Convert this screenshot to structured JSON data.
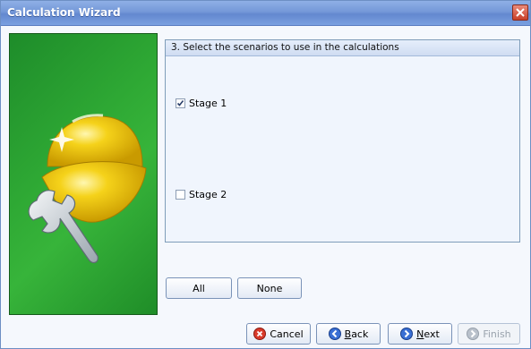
{
  "window": {
    "title": "Calculation Wizard"
  },
  "panel": {
    "header": "3. Select the scenarios to use in the calculations",
    "items": [
      {
        "label": "Stage 1",
        "checked": true
      },
      {
        "label": "Stage 2",
        "checked": false
      }
    ]
  },
  "selection_buttons": {
    "all": "All",
    "none": "None"
  },
  "footer": {
    "cancel": "Cancel",
    "back_first": "B",
    "back_rest": "ack",
    "next_first": "N",
    "next_rest": "ext",
    "finish": "Finish"
  },
  "icons": {
    "close": "close-icon",
    "banner": "hard-hat-wrench-icon",
    "cancel": "red-x-icon",
    "back": "blue-left-arrow-icon",
    "next": "blue-right-arrow-icon",
    "finish": "gray-right-arrow-icon"
  },
  "colors": {
    "title_bar": "#7498d8",
    "banner_green": "#2ea834",
    "panel_border": "#7f9db9"
  }
}
